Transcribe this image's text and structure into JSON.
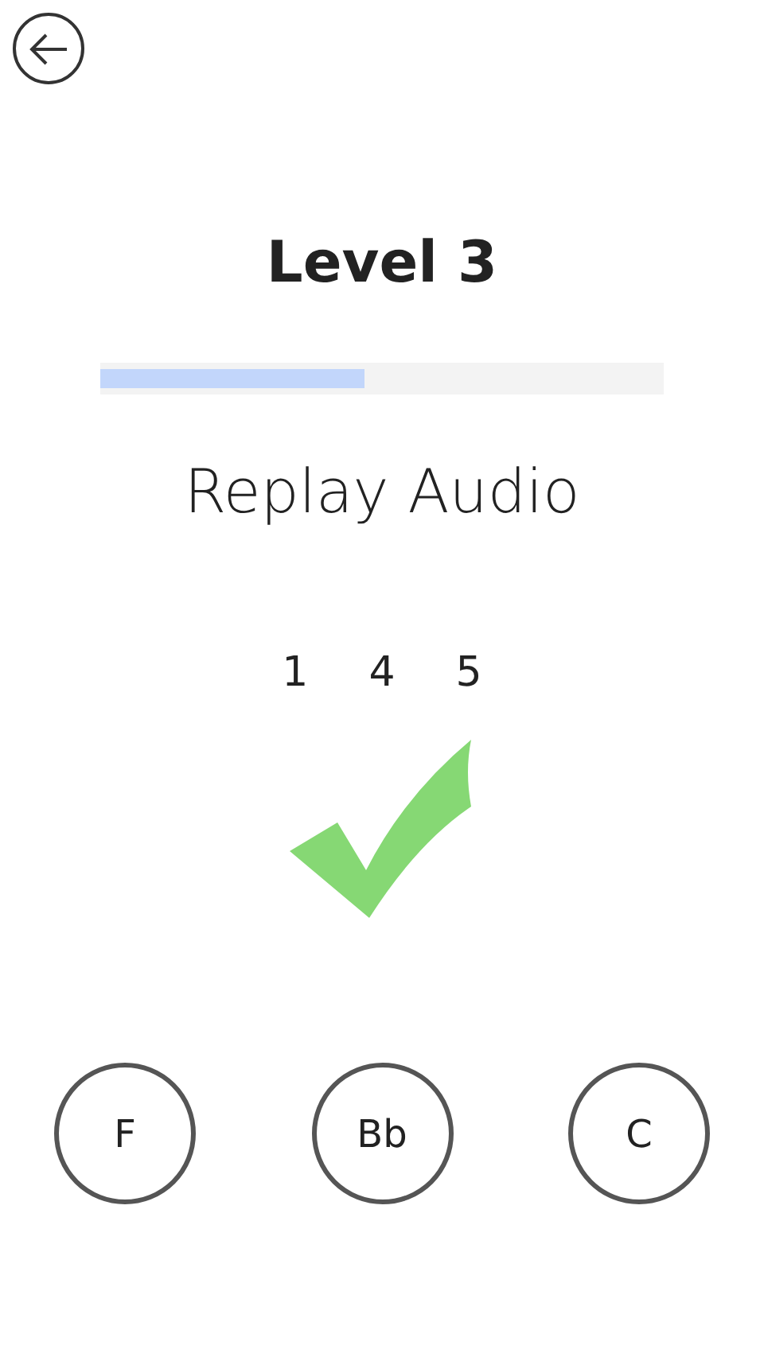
{
  "title": "Level 3",
  "progress": {
    "level": 0.47
  },
  "replay_button": {
    "label": "Replay Audio"
  },
  "sequence": [
    "1",
    "4",
    "5"
  ],
  "feedback": {
    "kind": "correct"
  },
  "answers": [
    {
      "label": "F"
    },
    {
      "label": "Bb"
    },
    {
      "label": "C"
    }
  ]
}
